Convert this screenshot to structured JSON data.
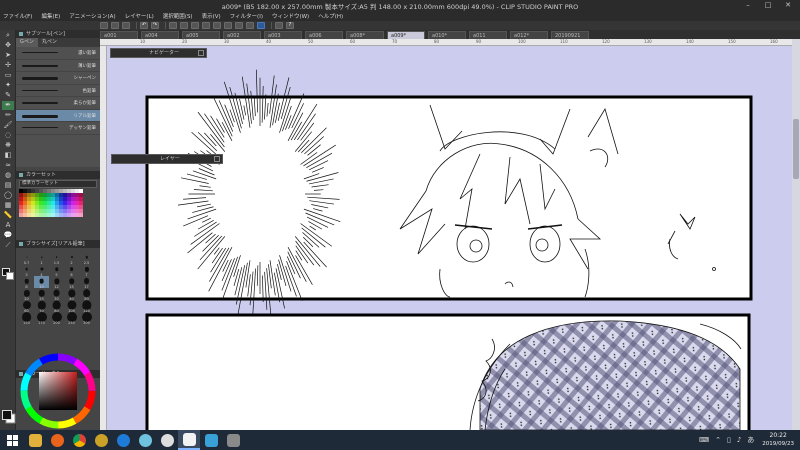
{
  "window": {
    "title": "a009* (B5 182.00 x 257.00mm 製本サイズ:A5 判 148.00 x 210.00mm 600dpi 49.0%) - CLIP STUDIO PAINT PRO"
  },
  "menu": [
    "ファイル(F)",
    "編集(E)",
    "アニメーション(A)",
    "レイヤー(L)",
    "選択範囲(S)",
    "表示(V)",
    "フィルター(I)",
    "ウィンドウ(W)",
    "ヘルプ(H)"
  ],
  "tabs": [
    {
      "label": "a001",
      "active": false
    },
    {
      "label": "a004",
      "active": false
    },
    {
      "label": "a005",
      "active": false
    },
    {
      "label": "a002",
      "active": false
    },
    {
      "label": "a003",
      "active": false
    },
    {
      "label": "a006",
      "active": false
    },
    {
      "label": "a008*",
      "active": false
    },
    {
      "label": "a009*",
      "active": true
    },
    {
      "label": "a010*",
      "active": false
    },
    {
      "label": "a011",
      "active": false
    },
    {
      "label": "a012*",
      "active": false
    },
    {
      "label": "20190921",
      "active": false
    }
  ],
  "ruler_labels": [
    "10",
    "20",
    "30",
    "40",
    "50",
    "60",
    "70",
    "80",
    "90",
    "100",
    "110",
    "120",
    "130",
    "140",
    "150",
    "160"
  ],
  "subtool": {
    "header": "サブツール[ペン]",
    "tabs": [
      "Gペン",
      "丸ペン"
    ],
    "brushes": [
      {
        "name": "濃い鉛筆",
        "active": false
      },
      {
        "name": "薄い鉛筆",
        "active": false
      },
      {
        "name": "シャーペン",
        "active": false
      },
      {
        "name": "色鉛筆",
        "active": false
      },
      {
        "name": "柔らか鉛筆",
        "active": false
      },
      {
        "name": "リアル鉛筆",
        "active": true
      },
      {
        "name": "デッサン鉛筆",
        "active": false
      }
    ]
  },
  "colorset": {
    "header": "カラーセット",
    "selected": "標準カラーセット"
  },
  "brushsize": {
    "header": "ブラシサイズ[リアル鉛筆]",
    "sizes": [
      "0.7",
      "1",
      "1.5",
      "2",
      "2.5",
      "3",
      "4",
      "5",
      "6",
      "7",
      "8",
      "10",
      "12",
      "15",
      "17",
      "20",
      "25",
      "30",
      "40",
      "50",
      "60",
      "70",
      "80",
      "100",
      "120",
      "150",
      "170",
      "200",
      "250",
      "300"
    ],
    "active_index": 11
  },
  "colorcircle": {
    "header": "カラーサークル"
  },
  "palettes": {
    "navigator": "ナビゲーター",
    "layer": "レイヤー"
  },
  "taskbar": {
    "time": "20:22",
    "date": "2019/09/23"
  },
  "colors": {
    "canvas_bg": "#ccccee",
    "panel_bg": "#454545",
    "accent": "#6b8aa8"
  }
}
